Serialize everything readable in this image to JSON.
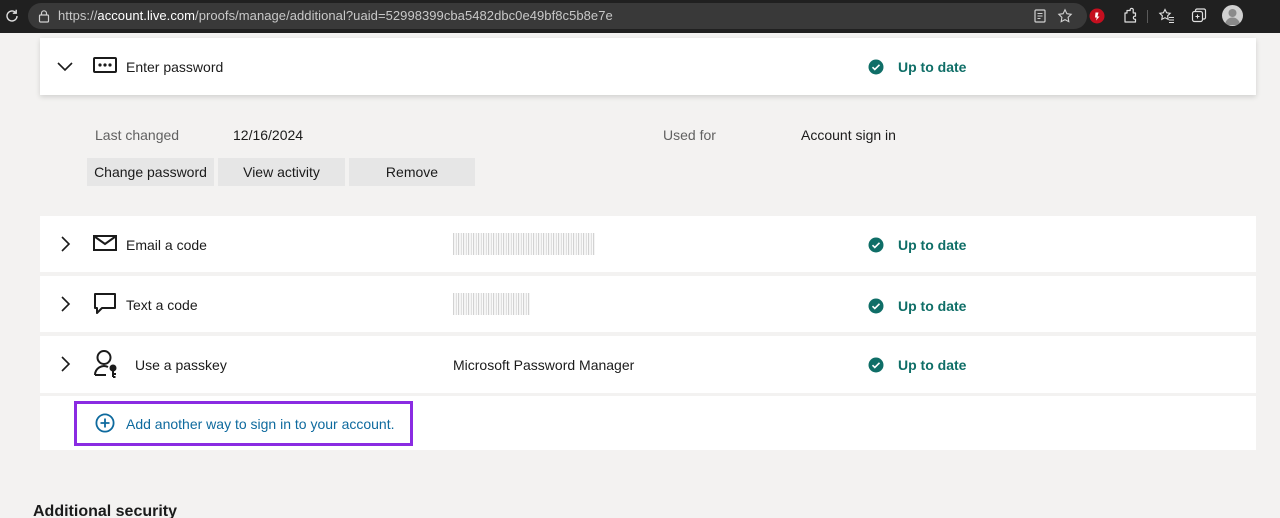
{
  "browser": {
    "url_scheme": "https://",
    "url_host": "account.live.com",
    "url_path": "/proofs/manage/additional?uaid=52998399cba5482dbc0e49bf8c5b8e7e"
  },
  "methods": {
    "password": {
      "label": "Enter password",
      "status": "Up to date",
      "details": {
        "last_changed_label": "Last changed",
        "last_changed_value": "12/16/2024",
        "used_for_label": "Used for",
        "used_for_value": "Account sign in",
        "buttons": {
          "change": "Change password",
          "activity": "View activity",
          "remove": "Remove"
        }
      }
    },
    "email": {
      "label": "Email a code",
      "status": "Up to date"
    },
    "text": {
      "label": "Text a code",
      "status": "Up to date"
    },
    "passkey": {
      "label": "Use a passkey",
      "detail": "Microsoft Password Manager",
      "status": "Up to date"
    }
  },
  "add_method": {
    "label": "Add another way to sign in to your account."
  },
  "sections": {
    "additional_security": "Additional security"
  },
  "colors": {
    "accent_teal": "#0f6e67",
    "link_blue": "#0e6a9e",
    "highlight_purple": "#8a2be2"
  }
}
